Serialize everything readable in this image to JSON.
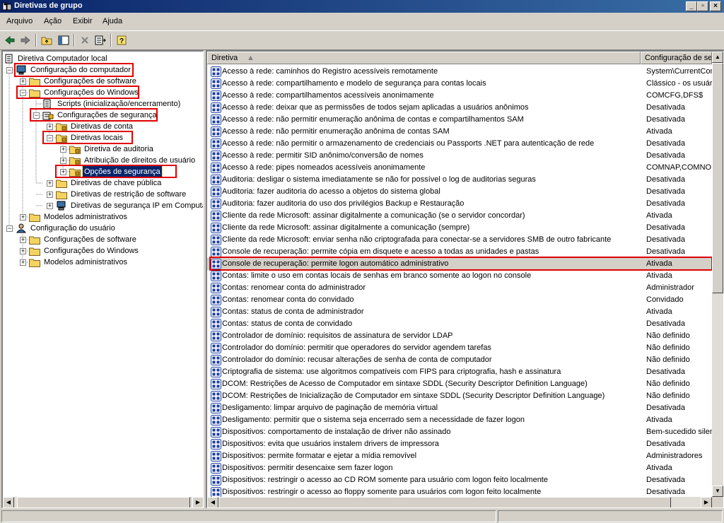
{
  "window": {
    "title": "Diretivas de grupo"
  },
  "menu": {
    "items": [
      {
        "label": "Arquivo"
      },
      {
        "label": "Ação"
      },
      {
        "label": "Exibir"
      },
      {
        "label": "Ajuda"
      }
    ]
  },
  "tree": {
    "items": [
      {
        "label": "Diretiva Computador local"
      },
      {
        "label": "Configuração do computador"
      },
      {
        "label": "Configurações de software"
      },
      {
        "label": "Configurações do Windows"
      },
      {
        "label": "Scripts (inicialização/encerramento)"
      },
      {
        "label": "Configurações de segurança"
      },
      {
        "label": "Diretivas de conta"
      },
      {
        "label": "Diretivas locais"
      },
      {
        "label": "Diretiva de auditoria"
      },
      {
        "label": "Atribuição de direitos de usuário"
      },
      {
        "label": "Opções de segurança"
      },
      {
        "label": "Diretivas de chave pública"
      },
      {
        "label": "Diretivas de restrição de software"
      },
      {
        "label": "Diretivas de segurança IP em Computador local"
      },
      {
        "label": "Modelos administrativos"
      },
      {
        "label": "Configuração do usuário"
      },
      {
        "label": "Configurações de software"
      },
      {
        "label": "Configurações do Windows"
      },
      {
        "label": "Modelos administrativos"
      }
    ]
  },
  "list": {
    "columns": {
      "policy": "Diretiva",
      "setting": "Configuração de se"
    },
    "rows": [
      {
        "policy": "Acesso à rede: caminhos do Registro acessíveis remotamente",
        "setting": "System\\CurrentCon"
      },
      {
        "policy": "Acesso à rede: compartilhamento e modelo de segurança para contas locais",
        "setting": "Clássico - os usuári"
      },
      {
        "policy": "Acesso à rede: compartilhamentos acessíveis anonimamente",
        "setting": "COMCFG,DFS$"
      },
      {
        "policy": "Acesso à rede: deixar que as permissões de todos sejam aplicadas a usuários anônimos",
        "setting": "Desativada"
      },
      {
        "policy": "Acesso à rede: não permitir enumeração anônima de contas e compartilhamentos SAM",
        "setting": "Desativada"
      },
      {
        "policy": "Acesso à rede: não permitir enumeração anônima de contas SAM",
        "setting": "Ativada"
      },
      {
        "policy": "Acesso à rede: não permitir o armazenamento de credenciais ou Passports .NET para autenticação de rede",
        "setting": "Desativada"
      },
      {
        "policy": "Acesso à rede: permitir SID anônimo/conversão de nomes",
        "setting": "Desativada"
      },
      {
        "policy": "Acesso à rede: pipes nomeados acessíveis anonimamente",
        "setting": "COMNAP,COMNOD"
      },
      {
        "policy": "Auditoria: desligar o sistema imediatamente se não for possível o log de auditorias seguras",
        "setting": "Desativada"
      },
      {
        "policy": "Auditoria: fazer auditoria do acesso a objetos do sistema global",
        "setting": "Desativada"
      },
      {
        "policy": "Auditoria: fazer auditoria do uso dos privilégios Backup e Restauração",
        "setting": "Desativada"
      },
      {
        "policy": "Cliente da rede Microsoft: assinar digitalmente a comunicação (se o servidor concordar)",
        "setting": "Ativada"
      },
      {
        "policy": "Cliente da rede Microsoft: assinar digitalmente a comunicação (sempre)",
        "setting": "Desativada"
      },
      {
        "policy": "Cliente da rede Microsoft: enviar senha não criptografada para conectar-se a servidores SMB de outro fabricante",
        "setting": "Desativada"
      },
      {
        "policy": "Console de recuperação: permite cópia em disquete e acesso a todas as unidades e pastas",
        "setting": "Desativada"
      },
      {
        "policy": "Console de recuperação: permite logon automático administrativo",
        "setting": "Ativada"
      },
      {
        "policy": "Contas: limite o uso em contas locais de senhas em branco somente ao logon no console",
        "setting": "Ativada"
      },
      {
        "policy": "Contas: renomear conta do administrador",
        "setting": "Administrador"
      },
      {
        "policy": "Contas: renomear conta do convidado",
        "setting": "Convidado"
      },
      {
        "policy": "Contas: status de conta de administrador",
        "setting": "Ativada"
      },
      {
        "policy": "Contas: status de conta de convidado",
        "setting": "Desativada"
      },
      {
        "policy": "Controlador de domínio: requisitos de assinatura de servidor LDAP",
        "setting": "Não definido"
      },
      {
        "policy": "Controlador do domínio: permitir que operadores do servidor agendem tarefas",
        "setting": "Não definido"
      },
      {
        "policy": "Controlador do domínio: recusar alterações de senha de conta de computador",
        "setting": "Não definido"
      },
      {
        "policy": "Criptografia de sistema: use algoritmos compatíveis com FIPS para criptografia, hash e assinatura",
        "setting": "Desativada"
      },
      {
        "policy": "DCOM: Restrições de Acesso de Computador em sintaxe SDDL (Security Descriptor Definition Language)",
        "setting": "Não definido"
      },
      {
        "policy": "DCOM: Restrições de Inicialização de Computador em sintaxe SDDL (Security Descriptor Definition Language)",
        "setting": "Não definido"
      },
      {
        "policy": "Desligamento: limpar arquivo de paginação de memória virtual",
        "setting": "Desativada"
      },
      {
        "policy": "Desligamento: permitir que o sistema seja encerrado sem a necessidade de fazer logon",
        "setting": "Ativada"
      },
      {
        "policy": "Dispositivos: comportamento de instalação de driver não assinado",
        "setting": "Bem-sucedido silenc"
      },
      {
        "policy": "Dispositivos: evita que usuários instalem drivers de impressora",
        "setting": "Desativada"
      },
      {
        "policy": "Dispositivos: permite formatar e ejetar a mídia removível",
        "setting": "Administradores"
      },
      {
        "policy": "Dispositivos: permitir desencaixe sem fazer logon",
        "setting": "Ativada"
      },
      {
        "policy": "Dispositivos: restringir o acesso ao CD ROM somente para usuário com logon feito localmente",
        "setting": "Desativada"
      },
      {
        "policy": "Dispositivos: restringir o acesso ao floppy somente para usuários com logon feito localmente",
        "setting": "Desativada"
      }
    ]
  },
  "colors": {
    "titlebar": "#0a246a",
    "highlight_box": "#e00000",
    "selection": "#0a246a",
    "policy_icon": "#1f3fa0"
  }
}
